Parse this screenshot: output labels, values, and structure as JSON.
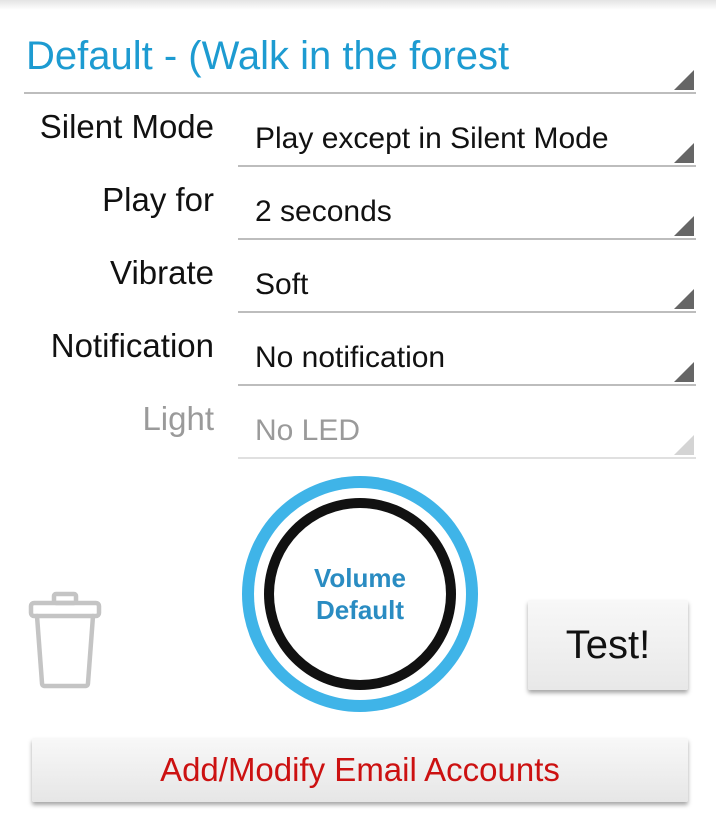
{
  "profile": {
    "selected": "Default - (Walk in the forest"
  },
  "rows": [
    {
      "label": "Silent Mode",
      "value": "Play except in Silent Mode",
      "enabled": true
    },
    {
      "label": "Play for",
      "value": "2 seconds",
      "enabled": true
    },
    {
      "label": "Vibrate",
      "value": "Soft",
      "enabled": true
    },
    {
      "label": "Notification",
      "value": "No notification",
      "enabled": true
    },
    {
      "label": "Light",
      "value": "No LED",
      "enabled": false
    }
  ],
  "volume": {
    "line1": "Volume",
    "line2": "Default"
  },
  "buttons": {
    "test": "Test!",
    "email_accounts": "Add/Modify Email Accounts"
  },
  "icons": {
    "delete": "trash-icon"
  },
  "colors": {
    "accent": "#1d9bd1",
    "volume_ring": "#3fb4e8",
    "email_button_text": "#cc1111"
  }
}
